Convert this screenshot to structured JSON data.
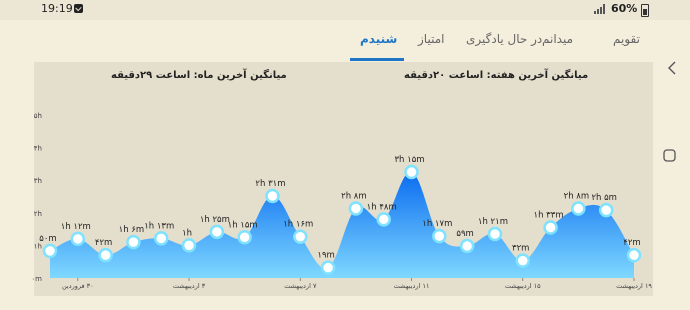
{
  "status_bar": {
    "time": "19:19",
    "battery": "60%"
  },
  "tabs": [
    {
      "label": "تقویم",
      "active": false
    },
    {
      "label": "میدانم",
      "active": false
    },
    {
      "label": "در حال یادگیری",
      "active": false
    },
    {
      "label": "امتیاز",
      "active": false
    },
    {
      "label": "شنیدم",
      "active": true
    }
  ],
  "colors": {
    "accent": "#1f76c7",
    "background": "#f4eedd",
    "chart_background": "#e4decc",
    "area_top": "#0a6cf0",
    "area_bottom": "#7fd8ff",
    "point_fill": "#ffffff",
    "point_ring": "#7fe2ff"
  },
  "summary": {
    "week_avg": "میانگین آخرین هفته:  اساعت  ۲۰دقیقه",
    "month_avg": "میانگین آخرین ماه:  اساعت  ۲۹دقیقه"
  },
  "chart_data": {
    "type": "area",
    "y_ticks": [
      "۵h",
      "۴h",
      "۳h",
      "۲h",
      "۱h",
      "۰m"
    ],
    "ylim": [
      0,
      300
    ],
    "x_ticks": [
      "۳۰ فروردین",
      "۳ اردیبهشت",
      "۷ اردیبهشت",
      "۱۱ اردیبهشت",
      "۱۵ اردیبهشت",
      "۱۹ اردیبهشت"
    ],
    "x_tick_index": [
      1,
      5,
      9,
      13,
      17,
      21
    ],
    "values": [
      50,
      72,
      42,
      66,
      73,
      60,
      85,
      75,
      151,
      76,
      19,
      128,
      108,
      195,
      77,
      59,
      81,
      32,
      93,
      128,
      125,
      42
    ],
    "labels": [
      "۵۰m",
      "۱h ۱۲m",
      "۴۲m",
      "۱h ۶m",
      "۱h ۱۳m",
      "۱h",
      "۱h ۲۵m",
      "۱h ۱۵m",
      "۲h ۳۱m",
      "۱h ۱۶m",
      "۱۹m",
      "۲h ۸m",
      "۱h ۴۸m",
      "۳h ۱۵m",
      "۱h ۱۷m",
      "۵۹m",
      "۱h ۲۱m",
      "۳۲m",
      "۱h ۳۳m",
      "۲h ۸m",
      "۲h ۵m",
      "۴۲m"
    ],
    "grid": false,
    "legend": "none"
  }
}
